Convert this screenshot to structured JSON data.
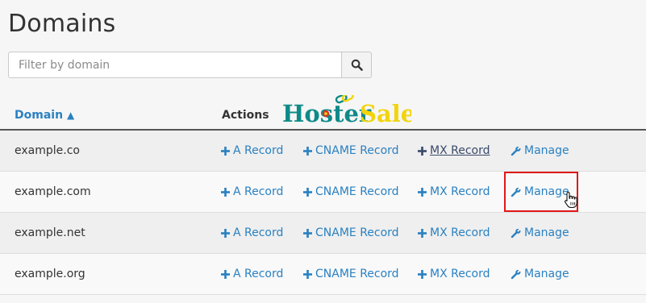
{
  "page": {
    "title": "Domains"
  },
  "search": {
    "placeholder": "Filter by domain",
    "button_icon": "search-icon"
  },
  "table": {
    "col_domain": "Domain",
    "sort_indicator": "▲",
    "col_actions": "Actions",
    "action_labels": {
      "a_record": "A Record",
      "cname_record": "CNAME Record",
      "mx_record": "MX Record",
      "manage": "Manage"
    },
    "rows": [
      {
        "domain": "example.co"
      },
      {
        "domain": "example.com"
      },
      {
        "domain": "example.net"
      },
      {
        "domain": "example.org"
      }
    ]
  },
  "logo": {
    "text_part1": "Hoster",
    "text_part2": "Sale"
  },
  "colors": {
    "link": "#2a81c1",
    "logo_teal": "#0e8a88",
    "logo_yellow": "#f2d40c",
    "highlight": "#e01818"
  },
  "icons": {
    "add": "plus-icon",
    "manage": "wrench-icon",
    "cursor": "hand-pointer-icon"
  }
}
